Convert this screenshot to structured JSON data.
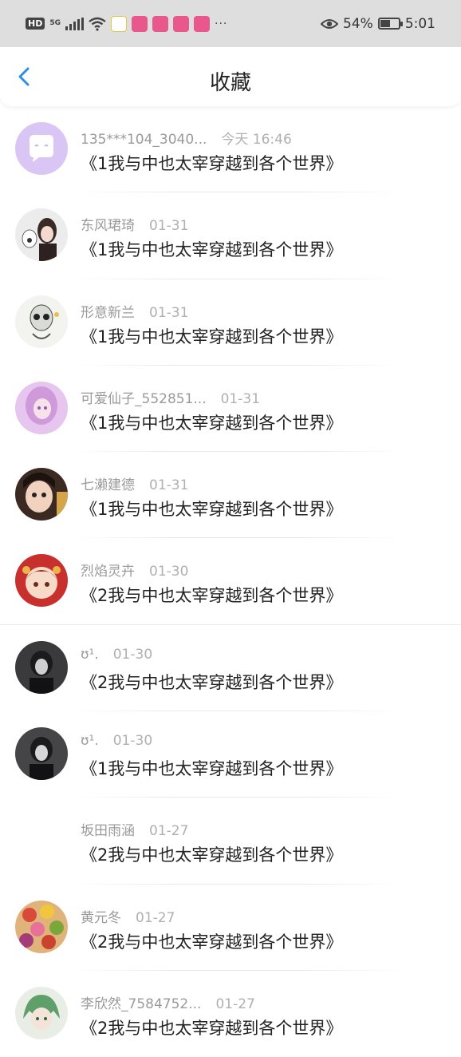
{
  "status_bar": {
    "hd": "HD",
    "network": "5G",
    "battery_percent": "54%",
    "battery_level": 0.54,
    "time": "5:01",
    "more": "···"
  },
  "header": {
    "title": "收藏"
  },
  "items": [
    {
      "user": "135***104_3040...",
      "time": "今天 16:46",
      "title": "《1我与中也太宰穿越到各个世界》"
    },
    {
      "user": "东风珺琦",
      "time": "01-31",
      "title": "《1我与中也太宰穿越到各个世界》"
    },
    {
      "user": "形意新兰",
      "time": "01-31",
      "title": "《1我与中也太宰穿越到各个世界》"
    },
    {
      "user": "可爱仙子_552851...",
      "time": "01-31",
      "title": "《1我与中也太宰穿越到各个世界》"
    },
    {
      "user": "七濑建德",
      "time": "01-31",
      "title": "《1我与中也太宰穿越到各个世界》"
    },
    {
      "user": "烈焰灵卉",
      "time": "01-30",
      "title": "《2我与中也太宰穿越到各个世界》"
    },
    {
      "user": "ʊ¹.",
      "time": "01-30",
      "title": "《2我与中也太宰穿越到各个世界》"
    },
    {
      "user": "ʊ¹.",
      "time": "01-30",
      "title": "《1我与中也太宰穿越到各个世界》"
    },
    {
      "user": "坂田雨涵",
      "time": "01-27",
      "title": "《2我与中也太宰穿越到各个世界》"
    },
    {
      "user": "黄元冬",
      "time": "01-27",
      "title": "《2我与中也太宰穿越到各个世界》"
    },
    {
      "user": "李欣然_7584752...",
      "time": "01-27",
      "title": "《2我与中也太宰穿越到各个世界》"
    }
  ]
}
